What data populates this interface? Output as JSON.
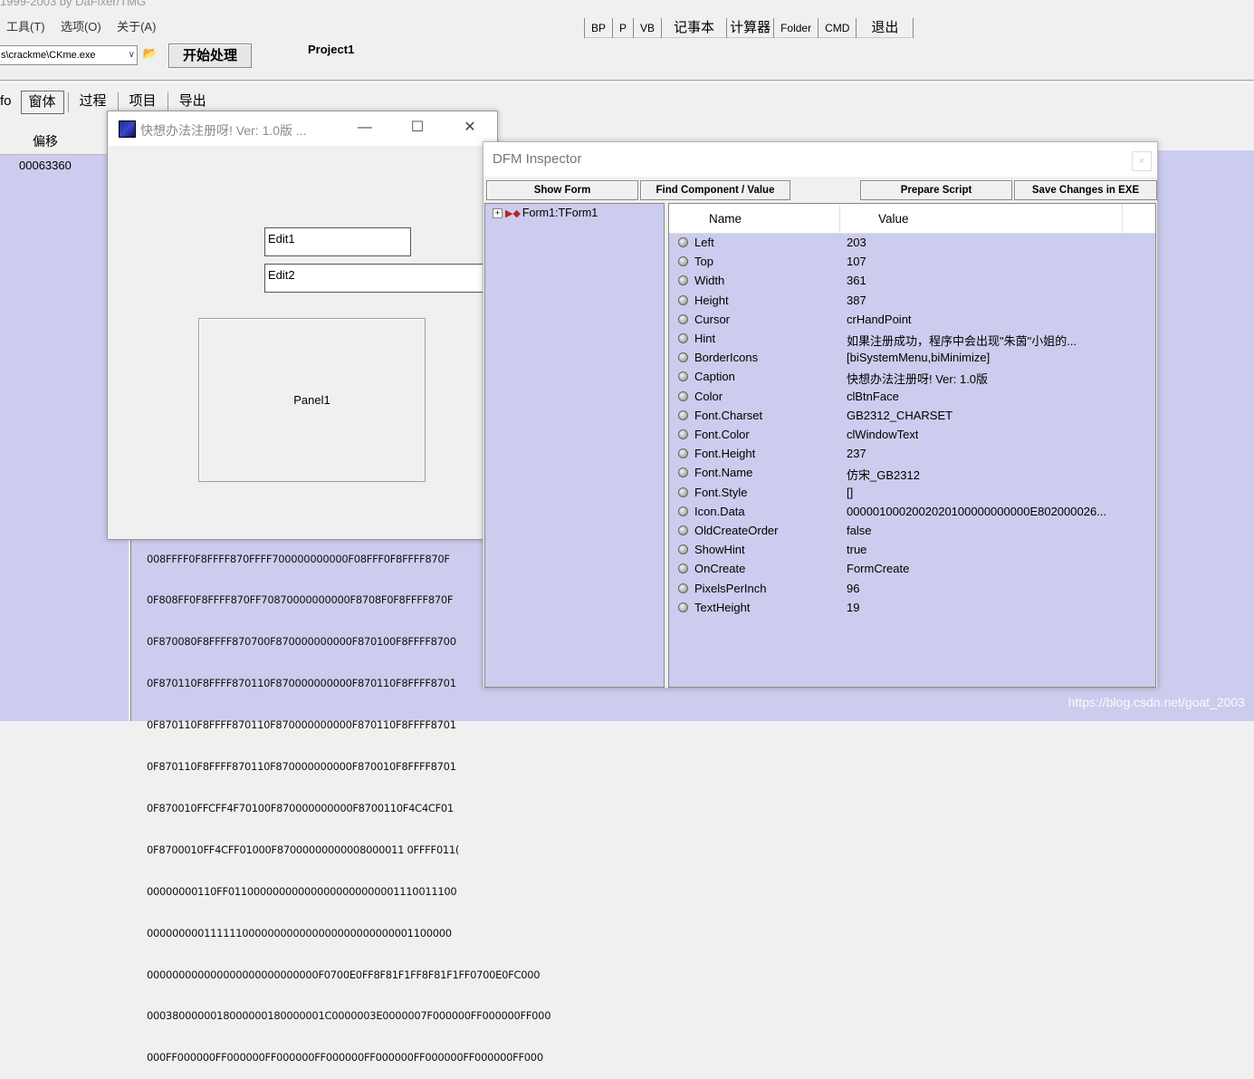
{
  "app": {
    "title": "1999-2003 by DaFixer/TMG",
    "menu": [
      "工具(T)",
      "选项(O)",
      "关于(A)"
    ],
    "path_value": "s\\crackme\\CKme.exe",
    "process_button": "开始处理",
    "project_label": "Project1",
    "tool_buttons": [
      "BP",
      "P",
      "VB",
      "记事本",
      "计算器",
      "Folder",
      "CMD",
      "退出"
    ],
    "tabs": [
      "fo",
      "窗体",
      "过程",
      "项目",
      "导出"
    ],
    "active_tab": "窗体",
    "column_offset": "偏移",
    "offset_value": "00063360",
    "hex_lines": [
      "008FFFF0F8FFFF870FFFF700000000000F08FFF0F8FFFF870F",
      "0F808FF0F8FFFF870FF70870000000000F8708F0F8FFFF870F",
      "0F870080F8FFFF870700F870000000000F870100F8FFFF8700",
      "0F870110F8FFFF870110F870000000000F870110F8FFFF8701",
      "0F870110F8FFFF870110F870000000000F870110F8FFFF8701",
      "0F870110F8FFFF870110F870000000000F870010F8FFFF8701",
      "0F870010FFCFF4F70100F870000000000F8700110F4C4CF01",
      "0F8700010FF4CFF01000F87000000000008000011 0FFFF011(",
      "00000000110FF011000000000000000000000001110011100",
      "000000000111111000000000000000000000000001100000",
      "000000000000000000000000000F0700E0FF8F81F1FF8F81F1FF0700E0FC000",
      "0003800000018000000180000001C0000003E0000007F000000FF000000FF000",
      "000FF000000FF000000FF000000FF000000FF000000FF000000FF000000FF000"
    ],
    "watermark": "https://blog.csdn.net/goat_2003"
  },
  "form_window": {
    "title": "快想办法注册呀!   Ver: 1.0版 ...",
    "controls": [
      "—",
      "☐",
      "✕"
    ],
    "edit1": "Edit1",
    "edit2": "Edit2",
    "panel1": "Panel1"
  },
  "dfm": {
    "title": "DFM Inspector",
    "close": "×",
    "buttons": {
      "show_form": "Show Form",
      "find_component": "Find Component / Value",
      "prepare_script": "Prepare Script",
      "save_changes": "Save Changes in EXE"
    },
    "tree_node": "Form1:TForm1",
    "tree_expander": "+",
    "columns": {
      "name": "Name",
      "value": "Value"
    },
    "properties": [
      {
        "name": "Left",
        "value": "203"
      },
      {
        "name": "Top",
        "value": "107"
      },
      {
        "name": "Width",
        "value": "361"
      },
      {
        "name": "Height",
        "value": "387"
      },
      {
        "name": "Cursor",
        "value": "crHandPoint"
      },
      {
        "name": "Hint",
        "value": "如果注册成功，程序中会出现\"朱茵\"小姐的..."
      },
      {
        "name": "BorderIcons",
        "value": "[biSystemMenu,biMinimize]"
      },
      {
        "name": "Caption",
        "value": "快想办法注册呀!   Ver: 1.0版"
      },
      {
        "name": "Color",
        "value": "clBtnFace"
      },
      {
        "name": "Font.Charset",
        "value": "GB2312_CHARSET"
      },
      {
        "name": "Font.Color",
        "value": "clWindowText"
      },
      {
        "name": "Font.Height",
        "value": "237"
      },
      {
        "name": "Font.Name",
        "value": "仿宋_GB2312"
      },
      {
        "name": "Font.Style",
        "value": "[]"
      },
      {
        "name": "Icon.Data",
        "value": "0000010002002020100000000000E802000026..."
      },
      {
        "name": "OldCreateOrder",
        "value": "false"
      },
      {
        "name": "ShowHint",
        "value": "true"
      },
      {
        "name": "OnCreate",
        "value": "FormCreate"
      },
      {
        "name": "PixelsPerInch",
        "value": "96"
      },
      {
        "name": "TextHeight",
        "value": "19"
      }
    ]
  }
}
